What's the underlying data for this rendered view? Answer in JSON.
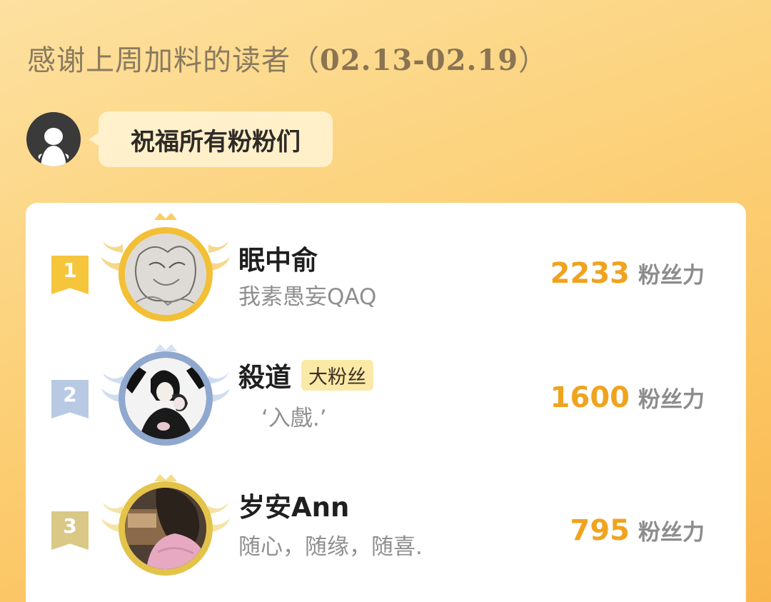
{
  "header": {
    "title_prefix": "感谢上周加料的读者",
    "open_paren": "（",
    "date_range": "02.13-02.19",
    "close_paren": "）"
  },
  "host": {
    "avatar_icon": "ghost-avatar-icon",
    "message": "祝福所有粉粉们"
  },
  "ranking": [
    {
      "rank": "1",
      "rank_color": "#f5c53c",
      "frame_color": "#f2bf36",
      "name": "眠中俞",
      "badge": "",
      "subtitle": "我素愚妄QAQ",
      "score": "2233",
      "unit": "粉丝力"
    },
    {
      "rank": "2",
      "rank_color": "#b8c9e4",
      "frame_color": "#8fa8cf",
      "name": "殺道",
      "badge": "大粉丝",
      "subtitle": "‘入戲.’",
      "score": "1600",
      "unit": "粉丝力"
    },
    {
      "rank": "3",
      "rank_color": "#d9c886",
      "frame_color": "#e3c34a",
      "name": "岁安Ann",
      "badge": "",
      "subtitle": "随心，随缘，随喜.",
      "score": "795",
      "unit": "粉丝力"
    }
  ]
}
